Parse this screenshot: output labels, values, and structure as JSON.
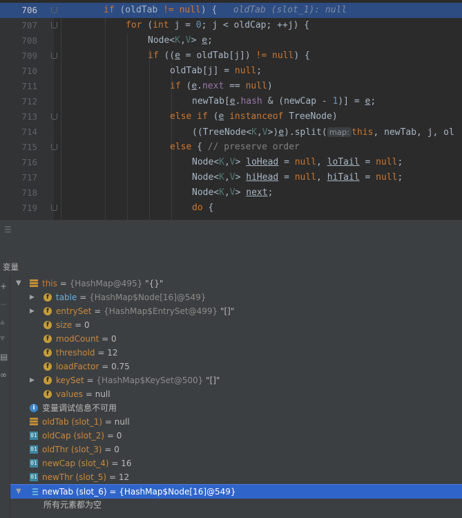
{
  "editor": {
    "lines": [
      {
        "num": "706",
        "tokens": [
          [
            "kw",
            "if "
          ],
          [
            "tp",
            "(oldTab "
          ],
          [
            "kw",
            "!= null"
          ],
          [
            "tp",
            ") { "
          ]
        ],
        "hint": "oldTab (slot_1): null",
        "current": true
      },
      {
        "num": "707",
        "tokens": [
          [
            "kw",
            "for "
          ],
          [
            "tp",
            "("
          ],
          [
            "kw",
            "int "
          ],
          [
            "tp",
            "j = "
          ],
          [
            "nm",
            "0"
          ],
          [
            "tp",
            "; j < oldCap; ++j) {"
          ]
        ]
      },
      {
        "num": "708",
        "tokens": [
          [
            "tp",
            "Node<"
          ],
          [
            "gen",
            "K"
          ],
          [
            "tp",
            ","
          ],
          [
            "gen",
            "V"
          ],
          [
            "tp",
            "> "
          ],
          [
            "u",
            "e"
          ],
          [
            "tp",
            ";"
          ]
        ]
      },
      {
        "num": "709",
        "tokens": [
          [
            "kw",
            "if "
          ],
          [
            "tp",
            "(("
          ],
          [
            "u",
            "e"
          ],
          [
            "tp",
            " = oldTab[j]) "
          ],
          [
            "kw",
            "!= null"
          ],
          [
            "tp",
            ") {"
          ]
        ]
      },
      {
        "num": "710",
        "tokens": [
          [
            "tp",
            "oldTab[j] = "
          ],
          [
            "kw",
            "null"
          ],
          [
            "tp",
            ";"
          ]
        ]
      },
      {
        "num": "711",
        "tokens": [
          [
            "kw",
            "if "
          ],
          [
            "tp",
            "("
          ],
          [
            "u",
            "e"
          ],
          [
            "tp",
            "."
          ],
          [
            "fld",
            "next"
          ],
          [
            "tp",
            " == "
          ],
          [
            "kw",
            "null"
          ],
          [
            "tp",
            ")"
          ]
        ]
      },
      {
        "num": "712",
        "tokens": [
          [
            "tp",
            "newTab["
          ],
          [
            "u",
            "e"
          ],
          [
            "tp",
            "."
          ],
          [
            "fld",
            "hash"
          ],
          [
            "tp",
            " & (newCap - "
          ],
          [
            "nm",
            "1"
          ],
          [
            "tp",
            ")] = "
          ],
          [
            "u",
            "e"
          ],
          [
            "tp",
            ";"
          ]
        ]
      },
      {
        "num": "713",
        "tokens": [
          [
            "kw",
            "else if "
          ],
          [
            "tp",
            "("
          ],
          [
            "u",
            "e"
          ],
          [
            "kw",
            " instanceof "
          ],
          [
            "tp",
            "TreeNode)"
          ]
        ]
      },
      {
        "num": "714",
        "tokens": [
          [
            "tp",
            "((TreeNode<"
          ],
          [
            "gen",
            "K"
          ],
          [
            "tp",
            ","
          ],
          [
            "gen",
            "V"
          ],
          [
            "tp",
            ">)"
          ],
          [
            "u",
            "e"
          ],
          [
            "tp",
            ").split("
          ]
        ],
        "param": "map:",
        "tail": [
          [
            "kw",
            "this"
          ],
          [
            "tp",
            ", newTab, j, ol"
          ]
        ]
      },
      {
        "num": "715",
        "tokens": [
          [
            "kw",
            "else "
          ],
          [
            "tp",
            "{ "
          ],
          [
            "cm",
            "// preserve order"
          ]
        ]
      },
      {
        "num": "716",
        "tokens": [
          [
            "tp",
            "Node<"
          ],
          [
            "gen",
            "K"
          ],
          [
            "tp",
            ","
          ],
          [
            "gen",
            "V"
          ],
          [
            "tp",
            "> "
          ],
          [
            "u",
            "loHead"
          ],
          [
            "tp",
            " = "
          ],
          [
            "kw",
            "null"
          ],
          [
            "tp",
            ", "
          ],
          [
            "u",
            "loTail"
          ],
          [
            "tp",
            " = "
          ],
          [
            "kw",
            "null"
          ],
          [
            "tp",
            ";"
          ]
        ]
      },
      {
        "num": "717",
        "tokens": [
          [
            "tp",
            "Node<"
          ],
          [
            "gen",
            "K"
          ],
          [
            "tp",
            ","
          ],
          [
            "gen",
            "V"
          ],
          [
            "tp",
            "> "
          ],
          [
            "u",
            "hiHead"
          ],
          [
            "tp",
            " = "
          ],
          [
            "kw",
            "null"
          ],
          [
            "tp",
            ", "
          ],
          [
            "u",
            "hiTail"
          ],
          [
            "tp",
            " = "
          ],
          [
            "kw",
            "null"
          ],
          [
            "tp",
            ";"
          ]
        ]
      },
      {
        "num": "718",
        "tokens": [
          [
            "tp",
            "Node<"
          ],
          [
            "gen",
            "K"
          ],
          [
            "tp",
            ","
          ],
          [
            "gen",
            "V"
          ],
          [
            "tp",
            "> "
          ],
          [
            "u",
            "next"
          ],
          [
            "tp",
            ";"
          ]
        ]
      },
      {
        "num": "719",
        "tokens": [
          [
            "kw",
            "do "
          ],
          [
            "tp",
            "{"
          ]
        ]
      }
    ]
  },
  "panel": {
    "title": "变量",
    "icons": [
      "add-icon",
      "remove-icon",
      "up-icon",
      "down-icon",
      "inspect-icon",
      "glasses-icon"
    ]
  },
  "variables": [
    {
      "indent": 0,
      "expand": "open",
      "icon": "stack",
      "name": "this",
      "nameClass": "orange",
      "eq": " = ",
      "type": "{HashMap@495}",
      "value": " \"{}\""
    },
    {
      "indent": 1,
      "expand": "closed",
      "icon": "field",
      "name": "table",
      "nameClass": "blue",
      "eq": " = ",
      "type": "{HashMap$Node[16]@549}",
      "value": ""
    },
    {
      "indent": 1,
      "expand": "closed",
      "icon": "field",
      "name": "entrySet",
      "nameClass": "",
      "eq": " = ",
      "type": "{HashMap$EntrySet@499}",
      "value": " \"[]\""
    },
    {
      "indent": 1,
      "expand": "",
      "icon": "field",
      "name": "size",
      "nameClass": "",
      "eq": " = ",
      "type": "",
      "value": "0"
    },
    {
      "indent": 1,
      "expand": "",
      "icon": "field",
      "name": "modCount",
      "nameClass": "",
      "eq": " = ",
      "type": "",
      "value": "0"
    },
    {
      "indent": 1,
      "expand": "",
      "icon": "field",
      "name": "threshold",
      "nameClass": "",
      "eq": " = ",
      "type": "",
      "value": "12"
    },
    {
      "indent": 1,
      "expand": "",
      "icon": "field",
      "name": "loadFactor",
      "nameClass": "",
      "eq": " = ",
      "type": "",
      "value": "0.75"
    },
    {
      "indent": 1,
      "expand": "closed",
      "icon": "field",
      "name": "keySet",
      "nameClass": "",
      "eq": " = ",
      "type": "{HashMap$KeySet@500}",
      "value": " \"[]\""
    },
    {
      "indent": 1,
      "expand": "",
      "icon": "field",
      "name": "values",
      "nameClass": "",
      "eq": " = ",
      "type": "",
      "value": "null"
    },
    {
      "indent": 0,
      "expand": "",
      "icon": "info",
      "name": "变量调试信息不可用",
      "nameClass": "plain",
      "eq": "",
      "type": "",
      "value": ""
    },
    {
      "indent": 0,
      "expand": "",
      "icon": "stack",
      "name": "oldTab (slot_1)",
      "nameClass": "",
      "eq": " = ",
      "type": "",
      "value": "null"
    },
    {
      "indent": 0,
      "expand": "",
      "icon": "prim",
      "name": "oldCap (slot_2)",
      "nameClass": "",
      "eq": " = ",
      "type": "",
      "value": "0"
    },
    {
      "indent": 0,
      "expand": "",
      "icon": "prim",
      "name": "oldThr (slot_3)",
      "nameClass": "",
      "eq": " = ",
      "type": "",
      "value": "0"
    },
    {
      "indent": 0,
      "expand": "",
      "icon": "prim",
      "name": "newCap (slot_4)",
      "nameClass": "",
      "eq": " = ",
      "type": "",
      "value": "16"
    },
    {
      "indent": 0,
      "expand": "",
      "icon": "prim",
      "name": "newThr (slot_5)",
      "nameClass": "",
      "eq": " = ",
      "type": "",
      "value": "12"
    },
    {
      "indent": 0,
      "expand": "open",
      "icon": "arr",
      "name": "newTab (slot_6)",
      "nameClass": "",
      "eq": " = ",
      "type": "{HashMap$Node[16]@549}",
      "value": "",
      "selected": true
    },
    {
      "indent": 1,
      "expand": "",
      "icon": "",
      "name": "所有元素都为空",
      "nameClass": "plain",
      "eq": "",
      "type": "",
      "value": ""
    }
  ]
}
